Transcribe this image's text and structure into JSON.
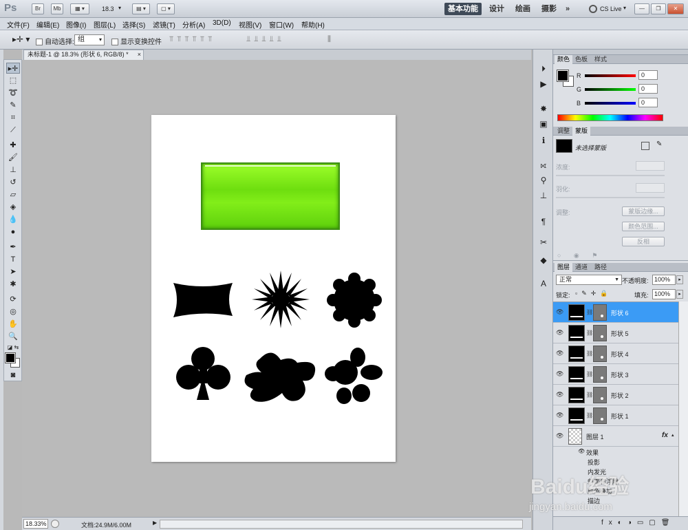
{
  "app": {
    "logo": "Ps"
  },
  "titlebar": {
    "btn_br": "Br",
    "btn_mb": "Mb",
    "zoom": "18.3",
    "workspaces": [
      "基本功能",
      "设计",
      "绘画",
      "摄影"
    ],
    "more": "»",
    "cs_live": "CS Live"
  },
  "menu": [
    "文件(F)",
    "编辑(E)",
    "图像(I)",
    "图层(L)",
    "选择(S)",
    "滤镜(T)",
    "分析(A)",
    "3D(D)",
    "视图(V)",
    "窗口(W)",
    "帮助(H)"
  ],
  "options": {
    "auto_select_label": "自动选择:",
    "auto_select_value": "组",
    "show_transform_label": "显示变换控件"
  },
  "document": {
    "tab_title": "未标题-1 @ 18.3% (形状 6, RGB/8) *",
    "close": "×",
    "status_zoom": "18.33%",
    "status_doc": "文档:24.9M/6.00M"
  },
  "color_panel": {
    "tabs": [
      "颜色",
      "色板",
      "样式"
    ],
    "r_label": "R",
    "g_label": "G",
    "b_label": "B",
    "r_value": "0",
    "g_value": "0",
    "b_value": "0"
  },
  "adjust_panel": {
    "tabs": [
      "调整",
      "蒙版"
    ],
    "no_mask": "未选择蒙版",
    "density": "浓度:",
    "feather": "羽化:",
    "refine": "调整:",
    "btn_edge": "蒙版边缘...",
    "btn_color_range": "颜色范围...",
    "btn_invert": "反相"
  },
  "layers_panel": {
    "tabs": [
      "图层",
      "通道",
      "路径"
    ],
    "blend_mode": "正常",
    "opacity_label": "不透明度:",
    "opacity_value": "100%",
    "lock_label": "锁定:",
    "fill_label": "填充:",
    "fill_value": "100%",
    "layers": [
      "形状 6",
      "形状 5",
      "形状 4",
      "形状 3",
      "形状 2",
      "形状 1"
    ],
    "layer1_name": "图层 1",
    "fx_label": "fx",
    "effects_label": "效果",
    "effects": [
      "投影",
      "内发光",
      "斜面和浮雕",
      "颜色叠加",
      "描边"
    ]
  },
  "watermark": {
    "brand": "Baidu经验",
    "url": "jingyan.baidu.com"
  },
  "colors": {
    "selected_layer": "#3b9bf5",
    "shape_fill": "#000000",
    "green_fill": "#7ee81a"
  }
}
